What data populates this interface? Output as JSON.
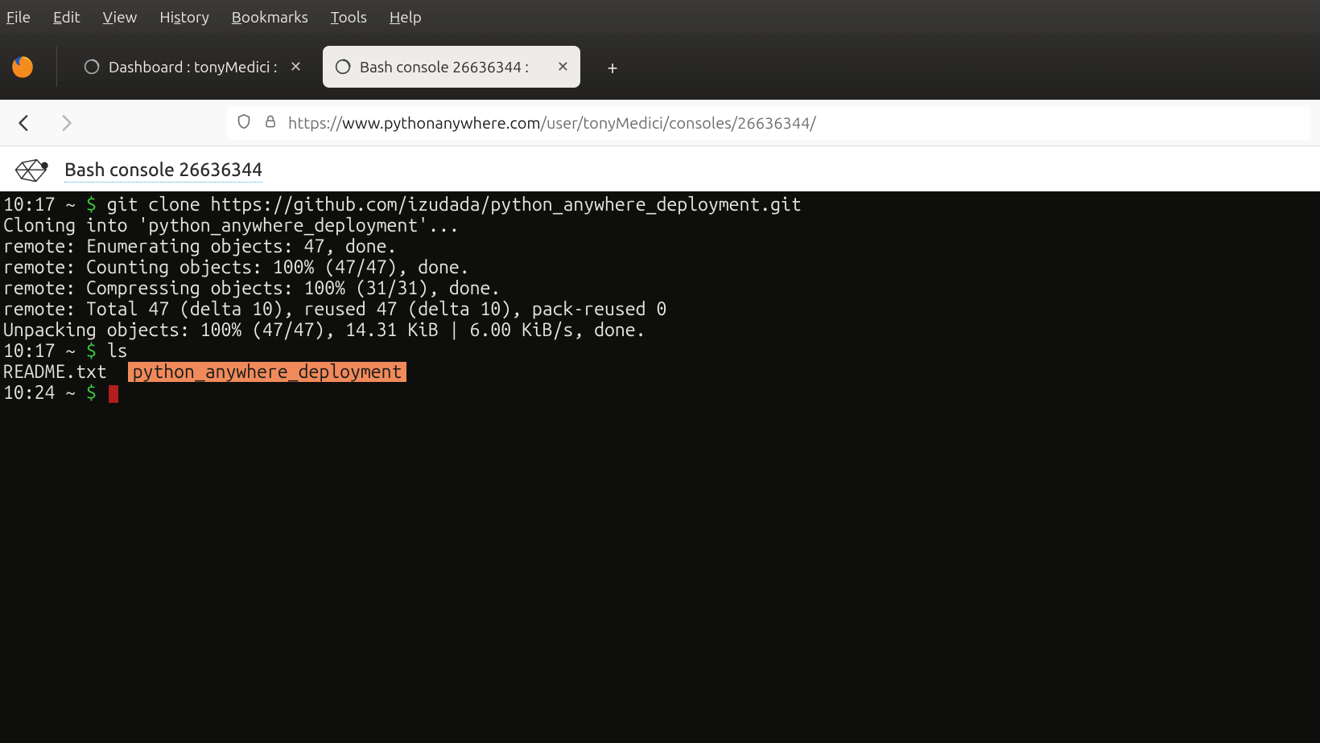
{
  "menu": {
    "file": "File",
    "edit": "Edit",
    "view": "View",
    "history": "History",
    "bookmarks": "Bookmarks",
    "tools": "Tools",
    "help": "Help"
  },
  "tabs": [
    {
      "label": "Dashboard : tonyMedici :",
      "active": false
    },
    {
      "label": "Bash console 26636344 :",
      "active": true
    }
  ],
  "url": {
    "proto": "https://",
    "host": "www.pythonanywhere.com",
    "path": "/user/tonyMedici/consoles/26636344/"
  },
  "page": {
    "title": "Bash console 26636344"
  },
  "terminal": {
    "lines": [
      {
        "type": "prompt_cmd",
        "time": "10:17",
        "dir": "~",
        "cmd": "git clone https://github.com/izudada/python_anywhere_deployment.git"
      },
      {
        "type": "out",
        "text": "Cloning into 'python_anywhere_deployment'..."
      },
      {
        "type": "out",
        "text": "remote: Enumerating objects: 47, done."
      },
      {
        "type": "out",
        "text": "remote: Counting objects: 100% (47/47), done."
      },
      {
        "type": "out",
        "text": "remote: Compressing objects: 100% (31/31), done."
      },
      {
        "type": "out",
        "text": "remote: Total 47 (delta 10), reused 47 (delta 10), pack-reused 0"
      },
      {
        "type": "out",
        "text": "Unpacking objects: 100% (47/47), 14.31 KiB | 6.00 KiB/s, done."
      },
      {
        "type": "prompt_cmd",
        "time": "10:17",
        "dir": "~",
        "cmd": "ls"
      },
      {
        "type": "ls",
        "plain": "README.txt  ",
        "highlight": "python_anywhere_deployment"
      },
      {
        "type": "prompt_cursor",
        "time": "10:24",
        "dir": "~"
      }
    ]
  }
}
